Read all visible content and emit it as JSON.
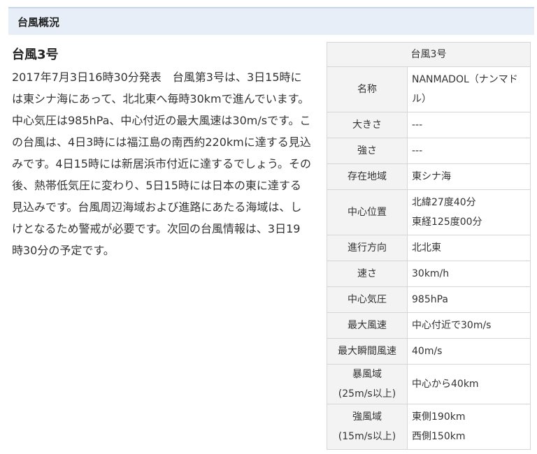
{
  "section_header": "台風概況",
  "title": "台風3号",
  "body": "2017年7月3日16時30分発表　台風第3号は、3日15時には東シナ海にあって、北北東へ毎時30kmで進んでいます。中心気圧は985hPa、中心付近の最大風速は30m/sです。この台風は、4日3時には福江島の南西約220kmに達する見込みです。4日15時には新居浜市付近に達するでしょう。その後、熱帯低気圧に変わり、5日15時には日本の東に達する見込みです。台風周辺海域および進路にあたる海域は、しけとなるため警戒が必要です。次回の台風情報は、3日19時30分の予定です。",
  "table": {
    "caption": "台風3号",
    "rows": [
      {
        "key": "名称",
        "values": [
          "NANMADOL（ナンマドル）"
        ]
      },
      {
        "key": "大きさ",
        "values": [
          "---"
        ]
      },
      {
        "key": "強さ",
        "values": [
          "---"
        ]
      },
      {
        "key": "存在地域",
        "values": [
          "東シナ海"
        ]
      },
      {
        "key": "中心位置",
        "values": [
          "北緯27度40分",
          "東経125度00分"
        ]
      },
      {
        "key": "進行方向",
        "values": [
          "北北東"
        ]
      },
      {
        "key": "速さ",
        "values": [
          "30km/h"
        ]
      },
      {
        "key": "中心気圧",
        "values": [
          "985hPa"
        ]
      },
      {
        "key": "最大風速",
        "values": [
          "中心付近で30m/s"
        ]
      },
      {
        "key": "最大瞬間風速",
        "values": [
          "40m/s"
        ]
      },
      {
        "key": [
          "暴風域",
          "(25m/s以上)"
        ],
        "values": [
          "中心から40km"
        ]
      },
      {
        "key": [
          "強風域",
          "(15m/s以上)"
        ],
        "values": [
          "東側190km",
          "西側150km"
        ]
      }
    ]
  }
}
